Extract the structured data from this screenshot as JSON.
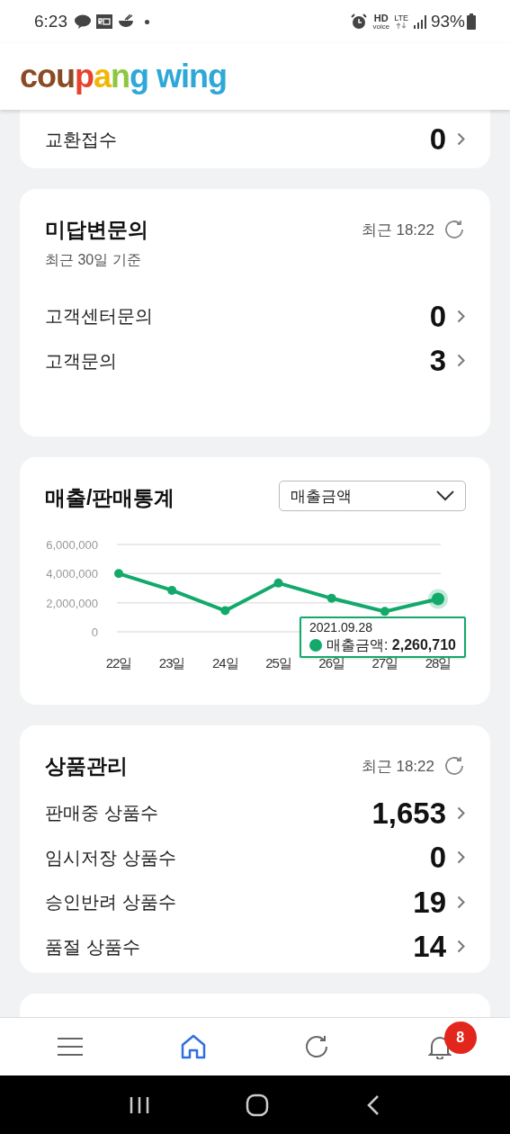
{
  "status_bar": {
    "time": "6:23",
    "indicators": [
      "HD",
      "voice",
      "LTE"
    ],
    "battery": "93%"
  },
  "logo": {
    "parts": [
      {
        "text": "cou",
        "color": "#8b4a24"
      },
      {
        "text": "p",
        "color": "#e8412c"
      },
      {
        "text": "a",
        "color": "#f2b705"
      },
      {
        "text": "n",
        "color": "#8dc63f"
      },
      {
        "text": "g",
        "color": "#2ea8d8"
      },
      {
        "text": " wing",
        "color": "#2ea8d8"
      }
    ]
  },
  "exchange_card": {
    "rows": [
      {
        "label": "교환접수",
        "value": "0"
      }
    ]
  },
  "inquiry_card": {
    "title": "미답변문의",
    "subtitle": "최근 30일 기준",
    "updated": "최근 18:22",
    "rows": [
      {
        "label": "고객센터문의",
        "value": "0"
      },
      {
        "label": "고객문의",
        "value": "3"
      }
    ]
  },
  "sales_card": {
    "title": "매출/판매통계",
    "dropdown": "매출금액",
    "chart_data": {
      "type": "line",
      "categories": [
        "22일",
        "23일",
        "24일",
        "25일",
        "26일",
        "27일",
        "28일"
      ],
      "series": [
        {
          "name": "매출금액",
          "color": "#12a96b",
          "marker": "circle",
          "values": [
            4000000,
            2850000,
            1450000,
            3350000,
            2300000,
            1400000,
            2260710
          ]
        }
      ],
      "ylim": [
        0,
        6000000
      ],
      "yticks": [
        {
          "value": 0,
          "label": "0"
        },
        {
          "value": 2000000,
          "label": "2,000,000"
        },
        {
          "value": 4000000,
          "label": "4,000,000"
        },
        {
          "value": 6000000,
          "label": "6,000,000"
        }
      ]
    },
    "tooltip": {
      "date": "2021.09.28",
      "separator": ":",
      "value": "2,260,710"
    }
  },
  "product_card": {
    "title": "상품관리",
    "updated": "최근 18:22",
    "rows": [
      {
        "label": "판매중 상품수",
        "value": "1,653"
      },
      {
        "label": "임시저장 상품수",
        "value": "0"
      },
      {
        "label": "승인반려 상품수",
        "value": "19"
      },
      {
        "label": "품절 상품수",
        "value": "14"
      }
    ]
  },
  "bottom_nav": {
    "items": [
      {
        "kind": "menu",
        "selected": false
      },
      {
        "kind": "home",
        "selected": true
      },
      {
        "kind": "refresh",
        "selected": false
      },
      {
        "kind": "bell",
        "selected": false,
        "badge": "8"
      }
    ]
  }
}
